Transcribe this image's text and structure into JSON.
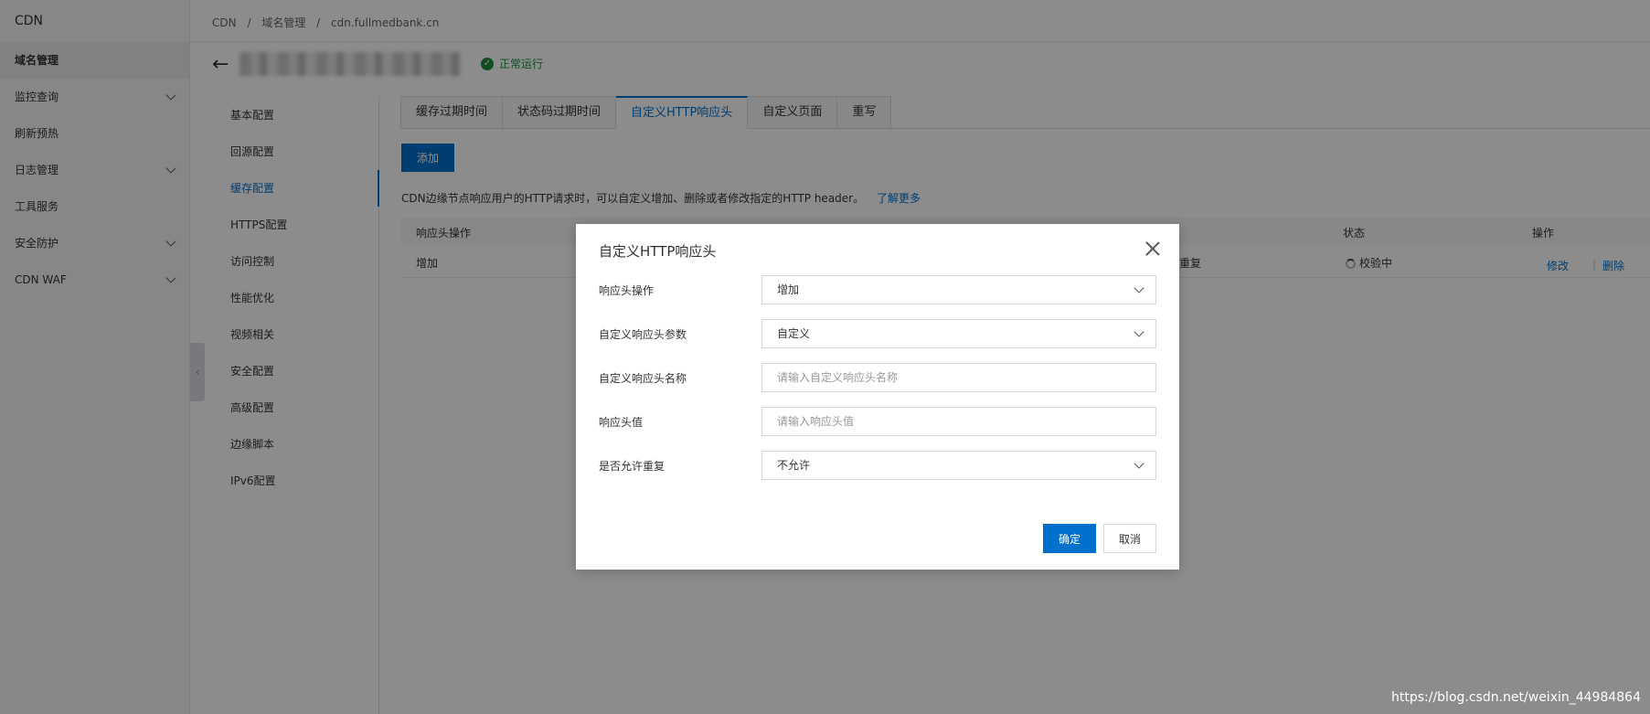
{
  "sidebar": {
    "brand": "CDN",
    "items": [
      {
        "label": "域名管理",
        "active": true,
        "expandable": false
      },
      {
        "label": "监控查询",
        "active": false,
        "expandable": true
      },
      {
        "label": "刷新预热",
        "active": false,
        "expandable": false
      },
      {
        "label": "日志管理",
        "active": false,
        "expandable": true
      },
      {
        "label": "工具服务",
        "active": false,
        "expandable": false
      },
      {
        "label": "安全防护",
        "active": false,
        "expandable": true
      },
      {
        "label": "CDN WAF",
        "active": false,
        "expandable": true
      }
    ]
  },
  "breadcrumb": [
    "CDN",
    "/",
    "域名管理",
    "/",
    "cdn.fullmedbank.cn"
  ],
  "domain_status": "正常运行",
  "subnav": [
    "基本配置",
    "回源配置",
    "缓存配置",
    "HTTPS配置",
    "访问控制",
    "性能优化",
    "视频相关",
    "安全配置",
    "高级配置",
    "边缘脚本",
    "IPv6配置"
  ],
  "subnav_active": "缓存配置",
  "tabs": [
    "缓存过期时间",
    "状态码过期时间",
    "自定义HTTP响应头",
    "自定义页面",
    "重写"
  ],
  "tab_active": "自定义HTTP响应头",
  "add_label": "添加",
  "description": "CDN边缘节点响应用户的HTTP请求时，可以自定义增加、删除或者修改指定的HTTP header。",
  "learn_more": "了解更多",
  "table": {
    "headers": {
      "op": "响应头操作",
      "status": "状态",
      "action": "操作"
    },
    "row": {
      "op": "增加",
      "repeat": "重复",
      "status": "校验中",
      "edit": "修改",
      "separator": "|",
      "delete": "删除"
    }
  },
  "modal": {
    "title": "自定义HTTP响应头",
    "fields": {
      "operation": {
        "label": "响应头操作",
        "value": "增加"
      },
      "param": {
        "label": "自定义响应头参数",
        "value": "自定义"
      },
      "name": {
        "label": "自定义响应头名称",
        "placeholder": "请输入自定义响应头名称"
      },
      "value": {
        "label": "响应头值",
        "placeholder": "请输入响应头值"
      },
      "repeat": {
        "label": "是否允许重复",
        "value": "不允许"
      }
    },
    "ok": "确定",
    "cancel": "取消"
  },
  "watermark": "https://blog.csdn.net/weixin_44984864",
  "colors": {
    "primary": "#0070cc",
    "success": "#1e8e3e"
  }
}
